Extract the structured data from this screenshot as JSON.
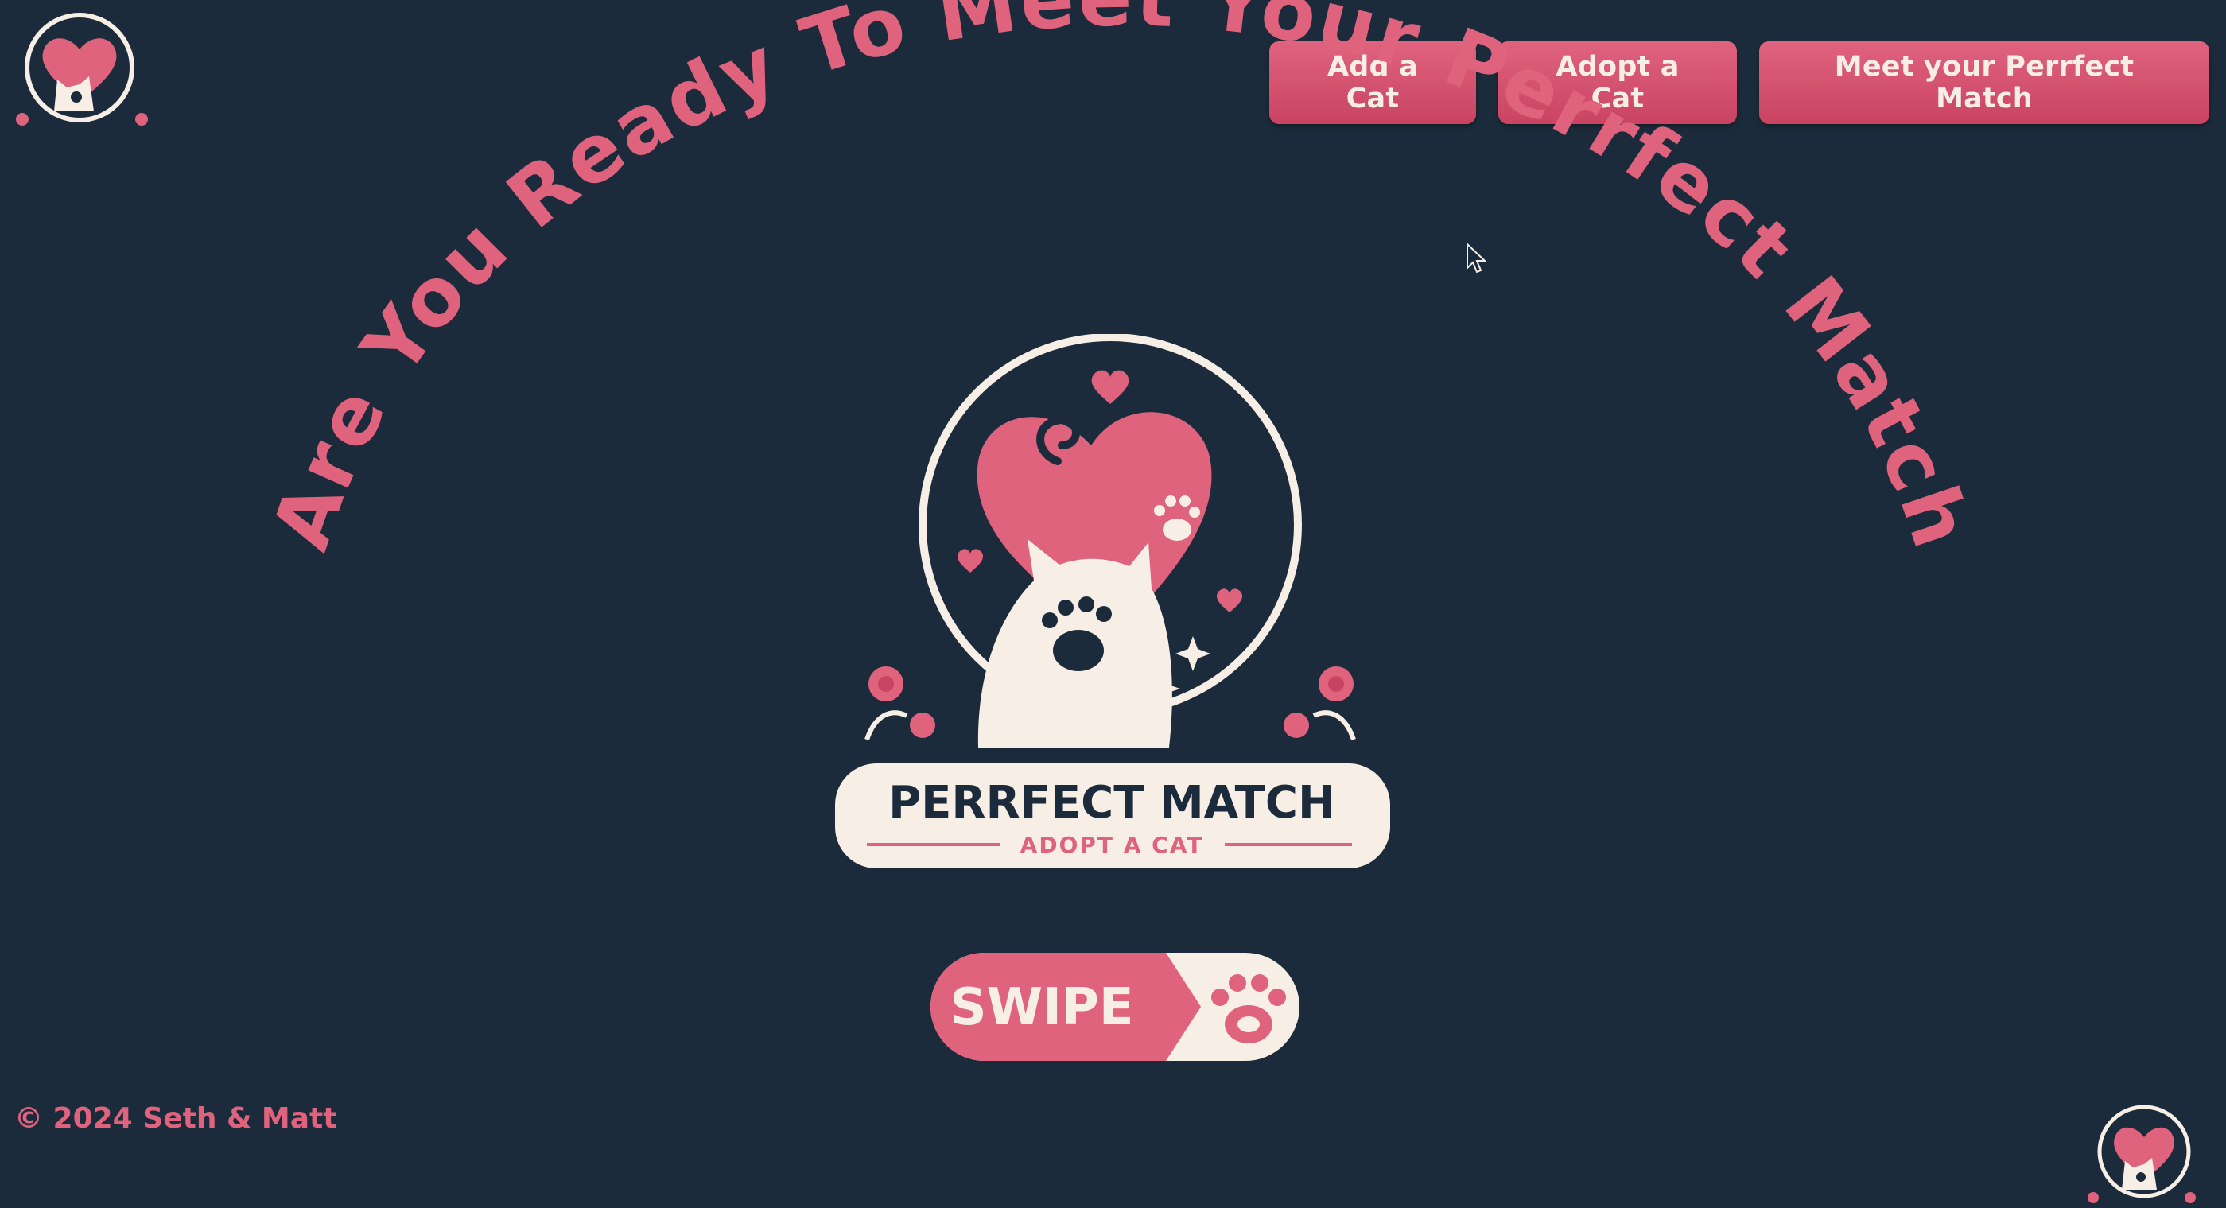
{
  "nav": {
    "add_cat": "Add a Cat",
    "adopt_cat": "Adopt a Cat",
    "meet_match": "Meet your Perrfect Match"
  },
  "hero": {
    "arc_heading": "Are You Ready To Meet Your Perrfect Match",
    "logo_title": "PERRFECT MATCH",
    "logo_subtitle": "ADOPT A CAT"
  },
  "swipe": {
    "label": "SWIPE"
  },
  "footer": {
    "copyright": "© 2024 Seth & Matt"
  },
  "colors": {
    "background": "#1c2b3b",
    "accent": "#e0637e",
    "accent_dark": "#c94462",
    "cream": "#f7efe6"
  },
  "icons": [
    "cat-heart-logo",
    "paw-icon",
    "heart-icon",
    "rose-icon",
    "cursor-icon"
  ]
}
